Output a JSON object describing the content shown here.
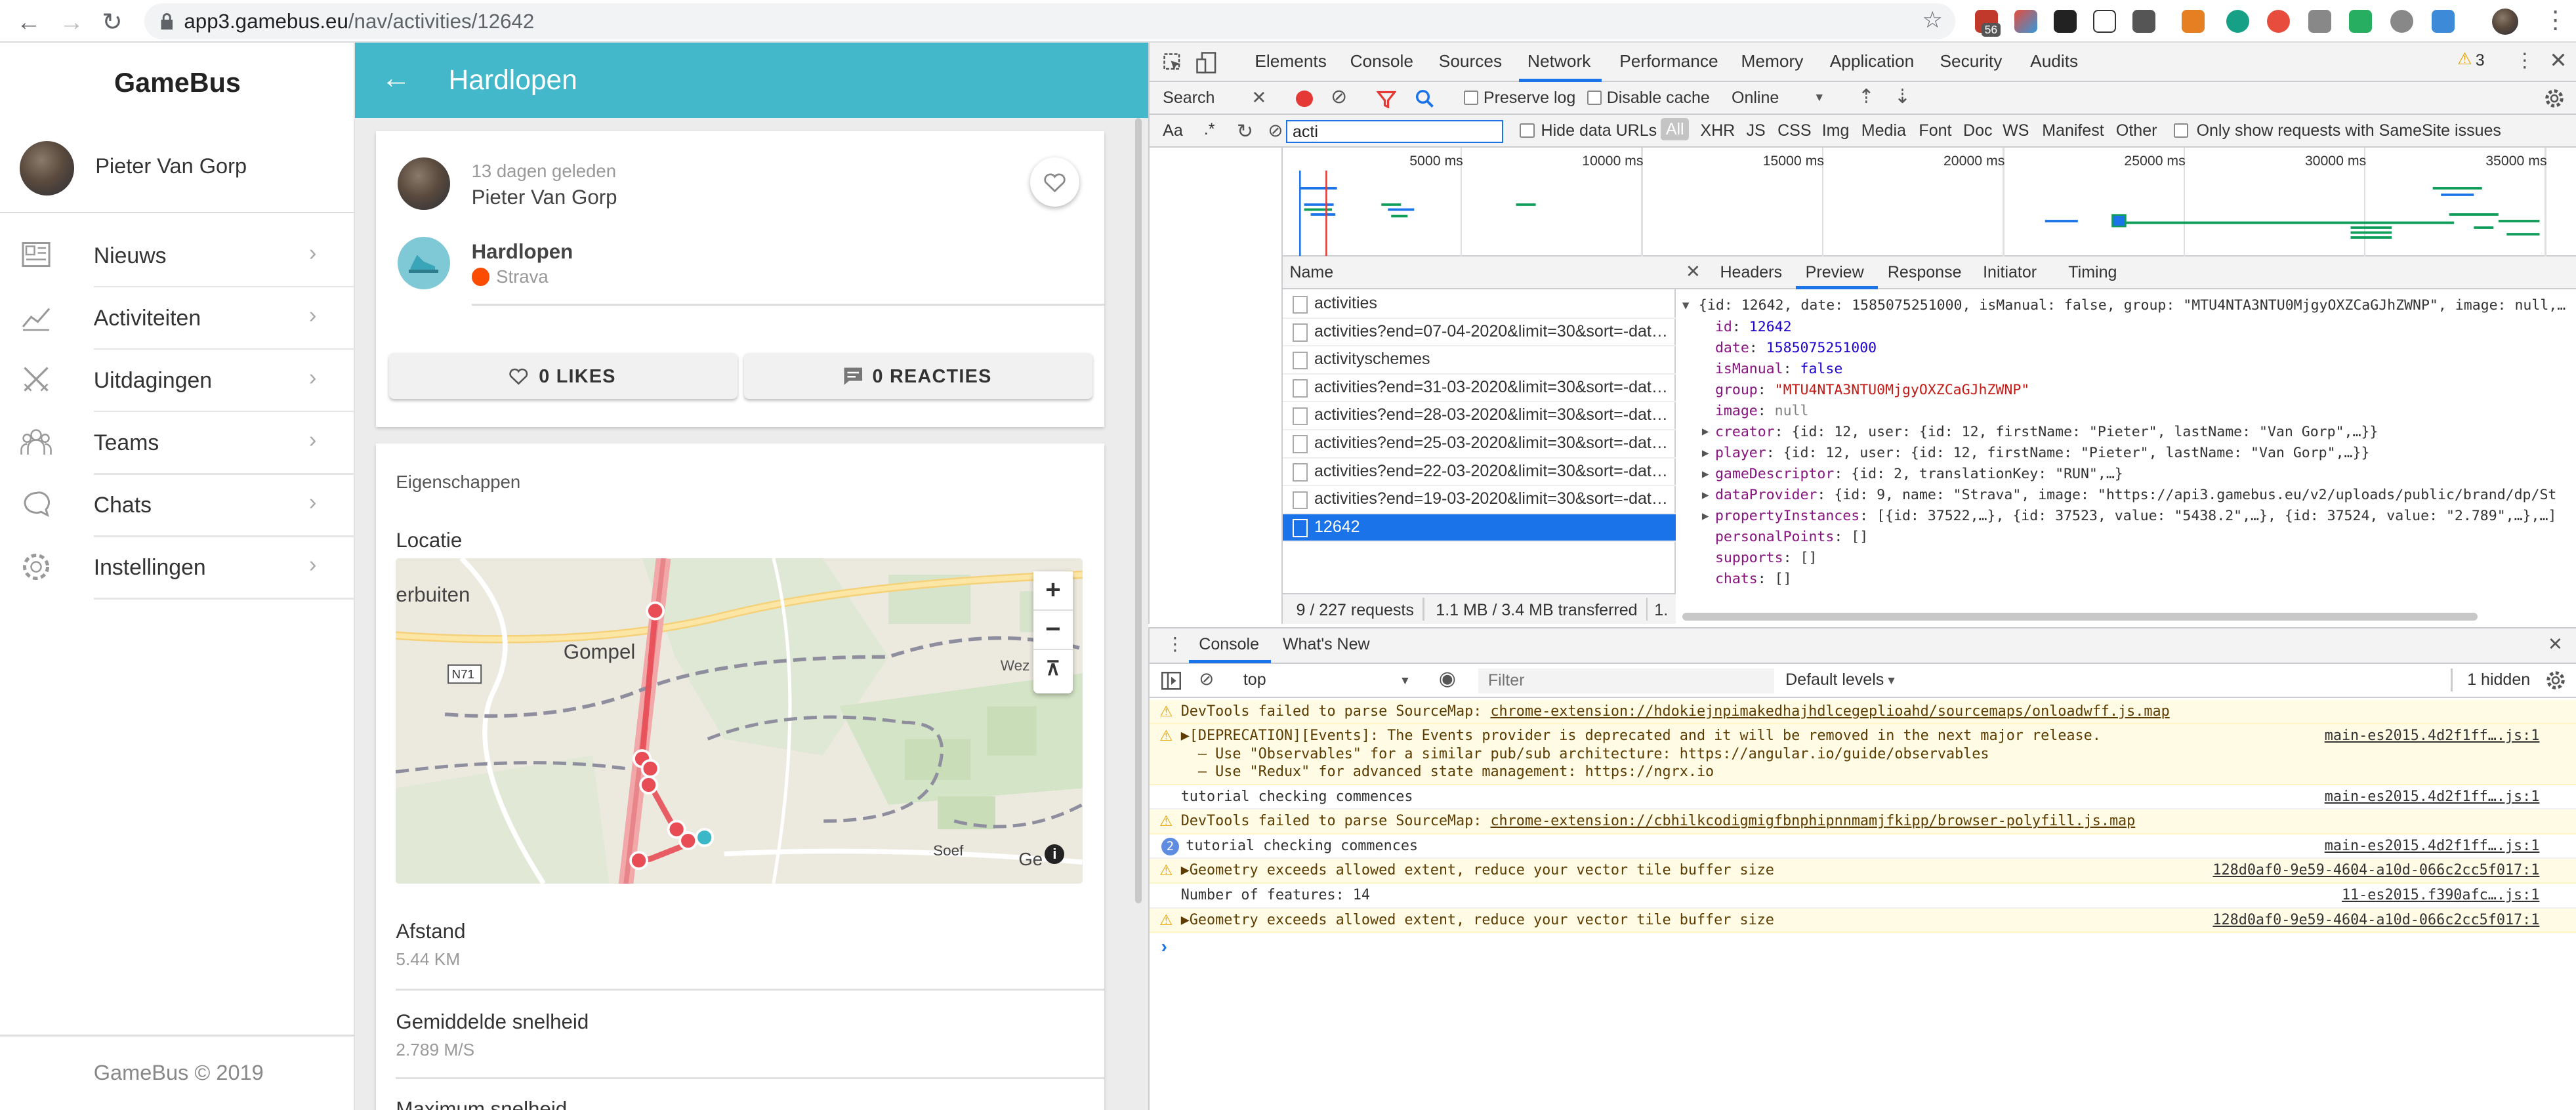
{
  "browser": {
    "url_host": "app3.gamebus.eu",
    "url_path": "/nav/activities/12642",
    "ext_badge": "56"
  },
  "sidebar": {
    "brand": "GameBus",
    "user": "Pieter Van Gorp",
    "items": [
      {
        "label": "Nieuws",
        "icon": "news-icon"
      },
      {
        "label": "Activiteiten",
        "icon": "chart-icon"
      },
      {
        "label": "Uitdagingen",
        "icon": "swords-icon"
      },
      {
        "label": "Teams",
        "icon": "teams-icon"
      },
      {
        "label": "Chats",
        "icon": "chat-icon"
      },
      {
        "label": "Instellingen",
        "icon": "gear-icon"
      }
    ],
    "footer": "GameBus © 2019"
  },
  "app": {
    "title": "Hardlopen",
    "post": {
      "time_ago": "13 dagen geleden",
      "author": "Pieter Van Gorp",
      "activity": "Hardlopen",
      "provider": "Strava",
      "likes": "0 LIKES",
      "reactions": "0 REACTIES"
    },
    "properties": {
      "heading": "Eigenschappen",
      "location_label": "Locatie",
      "distance_label": "Afstand",
      "distance_value": "5.44 KM",
      "avg_speed_label": "Gemiddelde snelheid",
      "avg_speed_value": "2.789 M/S",
      "max_speed_label": "Maximum snelheid"
    },
    "map": {
      "labels": [
        "erbuiten",
        "Gompel",
        "N71",
        "Soef",
        "Ge",
        "Wez"
      ],
      "zoom_in": "+",
      "zoom_out": "−",
      "reset": "⊼"
    }
  },
  "devtools": {
    "tabs": [
      "Elements",
      "Console",
      "Sources",
      "Network",
      "Performance",
      "Memory",
      "Application",
      "Security",
      "Audits"
    ],
    "active_tab": "Network",
    "warnings_count": "3",
    "search_title": "Search",
    "toolbar": {
      "preserve_log": "Preserve log",
      "disable_cache": "Disable cache",
      "throttle": "Online"
    },
    "filter": {
      "value": "acti",
      "hide_data_urls": "Hide data URLs",
      "types": [
        "All",
        "XHR",
        "JS",
        "CSS",
        "Img",
        "Media",
        "Font",
        "Doc",
        "WS",
        "Manifest",
        "Other"
      ],
      "samesite": "Only show requests with SameSite issues",
      "aa": "Aa",
      "regex": ".*"
    },
    "timeline_ticks": [
      "5000 ms",
      "10000 ms",
      "15000 ms",
      "20000 ms",
      "25000 ms",
      "30000 ms",
      "35000 ms"
    ],
    "requests": {
      "header": "Name",
      "items": [
        "activities",
        "activities?end=07-04-2020&limit=30&sort=-date...",
        "activityschemes",
        "activities?end=31-03-2020&limit=30&sort=-date...",
        "activities?end=28-03-2020&limit=30&sort=-date...",
        "activities?end=25-03-2020&limit=30&sort=-date...",
        "activities?end=22-03-2020&limit=30&sort=-date...",
        "activities?end=19-03-2020&limit=30&sort=-date...",
        "12642"
      ],
      "selected": "12642",
      "summary_count": "9 / 227 requests",
      "summary_size": "1.1 MB / 3.4 MB transferred",
      "summary_more": "1."
    },
    "detail_tabs": [
      "Headers",
      "Preview",
      "Response",
      "Initiator",
      "Timing"
    ],
    "detail_active": "Preview",
    "preview": {
      "root": "{id: 12642, date: 1585075251000, isManual: false, group: \"MTU4NTA3NTU0MjgyOXZCaGJhZWNP\", image: null,…",
      "fields": [
        {
          "k": "id",
          "v": "12642",
          "t": "n"
        },
        {
          "k": "date",
          "v": "1585075251000",
          "t": "n"
        },
        {
          "k": "isManual",
          "v": "false",
          "t": "n"
        },
        {
          "k": "group",
          "v": "\"MTU4NTA3NTU0MjgyOXZCaGJhZWNP\"",
          "t": "s"
        },
        {
          "k": "image",
          "v": "null",
          "t": "g"
        },
        {
          "k": "creator",
          "v": "{id: 12, user: {id: 12, firstName: \"Pieter\", lastName: \"Van Gorp\",…}}",
          "t": "o"
        },
        {
          "k": "player",
          "v": "{id: 12, user: {id: 12, firstName: \"Pieter\", lastName: \"Van Gorp\",…}}",
          "t": "o"
        },
        {
          "k": "gameDescriptor",
          "v": "{id: 2, translationKey: \"RUN\",…}",
          "t": "o"
        },
        {
          "k": "dataProvider",
          "v": "{id: 9, name: \"Strava\", image: \"https://api3.gamebus.eu/v2/uploads/public/brand/dp/St",
          "t": "o"
        },
        {
          "k": "propertyInstances",
          "v": "[{id: 37522,…}, {id: 37523, value: \"5438.2\",…}, {id: 37524, value: \"2.789\",…},…]",
          "t": "o"
        },
        {
          "k": "personalPoints",
          "v": "[]",
          "t": "p"
        },
        {
          "k": "supports",
          "v": "[]",
          "t": "p"
        },
        {
          "k": "chats",
          "v": "[]",
          "t": "p"
        }
      ]
    },
    "drawer": {
      "tabs": [
        "Console",
        "What's New"
      ],
      "context": "top",
      "filter_placeholder": "Filter",
      "levels": "Default levels",
      "hidden": "1 hidden",
      "messages": [
        {
          "type": "warn",
          "text": "DevTools failed to parse SourceMap: ",
          "link": "chrome-extension://hdokiejnpimakedhajhdlcegeplioahd/sourcemaps/onloadwff.js.map",
          "src": ""
        },
        {
          "type": "warn",
          "text": "▶[DEPRECATION][Events]: The Events provider is deprecated and it will be removed in the next major release.",
          "line2": "  – Use \"Observables\" for a similar pub/sub architecture: https://angular.io/guide/observables",
          "line3": "  – Use \"Redux\" for advanced state management: https://ngrx.io",
          "src": "main-es2015.4d2f1ff….js:1"
        },
        {
          "type": "log",
          "text": "tutorial checking commences",
          "src": "main-es2015.4d2f1ff….js:1"
        },
        {
          "type": "warn",
          "text": "DevTools failed to parse SourceMap: ",
          "link": "chrome-extension://cbhilkcodigmigfbnphipnnmamjfkipp/browser-polyfill.js.map",
          "src": ""
        },
        {
          "type": "log",
          "text": "tutorial checking commences",
          "src": "main-es2015.4d2f1ff….js:1",
          "count": "2"
        },
        {
          "type": "warn",
          "text": "▶Geometry exceeds allowed extent, reduce your vector tile buffer size",
          "src": "128d0af0-9e59-4604-a10d-066c2cc5f017:1"
        },
        {
          "type": "log",
          "text": "Number of features: 14",
          "src": "11-es2015.f390afc….js:1"
        },
        {
          "type": "warn",
          "text": "▶Geometry exceeds allowed extent, reduce your vector tile buffer size",
          "src": "128d0af0-9e59-4604-a10d-066c2cc5f017:1"
        }
      ],
      "prompt": "›"
    }
  }
}
